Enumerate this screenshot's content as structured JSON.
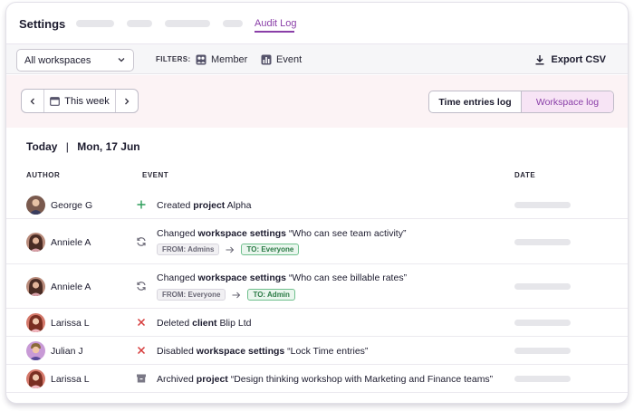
{
  "nav": {
    "title": "Settings",
    "active_tab": "Audit Log"
  },
  "filterbar": {
    "workspace_select": "All workspaces",
    "filters_label": "FILTERS:",
    "member_filter": "Member",
    "event_filter": "Event",
    "export_label": "Export CSV"
  },
  "datebar": {
    "range_label": "This week",
    "toggle": [
      "Time entries log",
      "Workspace log"
    ],
    "toggle_active": "Workspace log"
  },
  "day": {
    "today": "Today",
    "date": "Mon, 17 Jun"
  },
  "columns": {
    "author": "AUTHOR",
    "event": "EVENT",
    "date": "DATE"
  },
  "rows": [
    {
      "author": "George G",
      "icon": "plus-icon",
      "pre": "Created ",
      "bold": "project",
      "post": " Alpha"
    },
    {
      "author": "Anniele A",
      "icon": "refresh-icon",
      "pre": "Changed ",
      "bold": "workspace settings",
      "post": " “Who can see team activity”",
      "from": "FROM: Admins",
      "to": "TO: Everyone"
    },
    {
      "author": "Anniele A",
      "icon": "refresh-icon",
      "pre": "Changed ",
      "bold": "workspace settings",
      "post": " “Who can see billable rates”",
      "from": "FROM: Everyone",
      "to": "TO: Admin"
    },
    {
      "author": "Larissa L",
      "icon": "x-icon",
      "pre": "Deleted ",
      "bold": "client",
      "post": " Blip Ltd"
    },
    {
      "author": "Julian J",
      "icon": "x-icon",
      "pre": "Disabled ",
      "bold": "workspace settings",
      "post": " “Lock Time entries”"
    },
    {
      "author": "Larissa L",
      "icon": "archive-icon",
      "pre": "Archived ",
      "bold": "project",
      "post": " “Design thinking workshop with Marketing and Finance teams”"
    }
  ],
  "colors": {
    "accent": "#8a3fa8",
    "add": "#2e9e5b",
    "delete": "#d63a3a",
    "neutral": "#6a6876"
  }
}
